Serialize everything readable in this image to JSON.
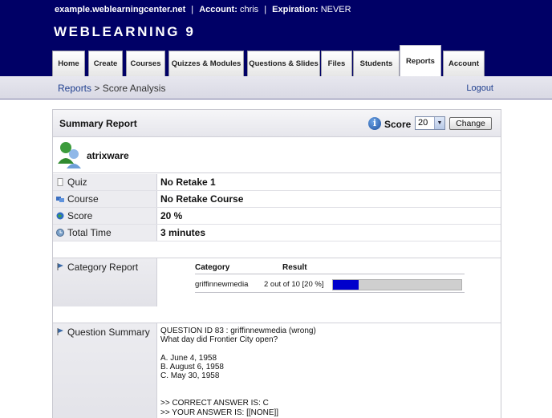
{
  "topbar": {
    "site": "example.weblearningcenter.net",
    "account_label": "Account:",
    "account_value": "chris",
    "expiration_label": "Expiration:",
    "expiration_value": "NEVER",
    "separator": "|"
  },
  "logo": "WEBLEARNING 9",
  "tabs": [
    {
      "label": "Home"
    },
    {
      "label": "Create"
    },
    {
      "label": "Courses"
    },
    {
      "label": "Quizzes & Modules"
    },
    {
      "label": "Questions & Slides"
    },
    {
      "label": "Files"
    },
    {
      "label": "Students"
    },
    {
      "label": "Reports",
      "active": true
    },
    {
      "label": "Account"
    }
  ],
  "breadcrumb": {
    "link": "Reports",
    "separator": ">",
    "current": "Score Analysis"
  },
  "logout": "Logout",
  "summary": {
    "title": "Summary Report",
    "score_label": "Score",
    "score_value": "20",
    "change_button": "Change",
    "user": "atrixware",
    "rows": [
      {
        "label": "Quiz",
        "value": "No Retake 1",
        "icon": "document-icon"
      },
      {
        "label": "Course",
        "value": "No Retake Course",
        "icon": "course-icon"
      },
      {
        "label": "Score",
        "value": "20 %",
        "icon": "globe-icon"
      },
      {
        "label": "Total Time",
        "value": "3 minutes",
        "icon": "clock-icon"
      }
    ]
  },
  "category_report": {
    "label": "Category Report",
    "col_category": "Category",
    "col_result": "Result",
    "rows": [
      {
        "category": "griffinnewmedia",
        "result": "2 out of 10 [20 %]",
        "percent": 20
      }
    ]
  },
  "question_summary": {
    "label": "Question Summary",
    "lines": [
      "QUESTION ID 83 : griffinnewmedia (wrong)",
      "What day did Frontier City open?",
      "",
      "A. June 4, 1958",
      "B. August 6, 1958",
      "C. May 30, 1958",
      "",
      "",
      ">> CORRECT ANSWER IS: C",
      ">> YOUR ANSWER IS: [[NONE]]"
    ]
  },
  "colors": {
    "header": "#000066",
    "bar_fill": "#0000cc",
    "link": "#1f3f8f"
  }
}
